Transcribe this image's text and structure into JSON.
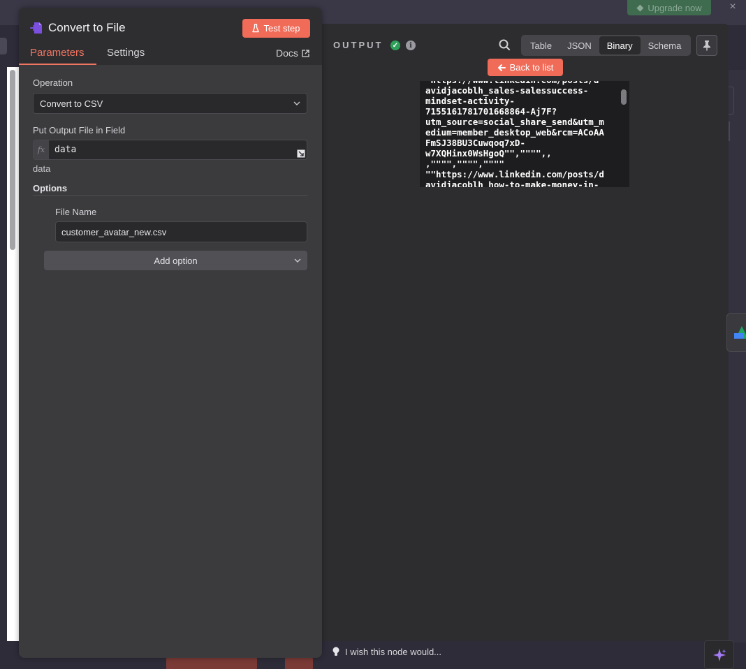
{
  "app": {
    "upgrade_label": "Upgrade now",
    "close_symbol": "×"
  },
  "node": {
    "title": "Convert to File",
    "icon": "convert-file-icon",
    "test_step_label": "Test step",
    "tabs": [
      {
        "label": "Parameters",
        "active": true
      },
      {
        "label": "Settings",
        "active": false
      }
    ],
    "docs_label": "Docs"
  },
  "parameters": {
    "operation_label": "Operation",
    "operation_value": "Convert to CSV",
    "output_field_label": "Put Output File in Field",
    "output_field_fx": "fx",
    "output_field_value": "data",
    "output_field_hint": "data",
    "options_label": "Options",
    "file_name_label": "File Name",
    "file_name_value": "customer_avatar_new.csv",
    "add_option_label": "Add option"
  },
  "output": {
    "title": "OUTPUT",
    "status": "success",
    "view_tabs": [
      {
        "label": "Table",
        "active": false
      },
      {
        "label": "JSON",
        "active": false
      },
      {
        "label": "Binary",
        "active": true
      },
      {
        "label": "Schema",
        "active": false
      }
    ],
    "back_label": "Back to list",
    "binary_preview": "\"https://www.linkedin.com/posts/d\navidjacoblh_sales-salessuccess-\nmindset-activity-\n7155161781701668864-Aj7F?\nutm_source=social_share_send&utm_m\nedium=member_desktop_web&rcm=ACoAA\nFmSJ38BU3Cuwqoq7xD-\nw7XQHinx0WsHgoQ\"\",\"\"\"\",,\n,\"\"\"\",\"\"\"\",\"\"\"\"\n\"\"https://www.linkedin.com/posts/d\navidjacoblh_how-to-make-money-in-",
    "feedback_text": "I wish this node would..."
  },
  "colors": {
    "accent": "#f06b58",
    "success": "#2fa05a",
    "panel_bg": "#3b3b3e",
    "output_bg": "#2d2d2f"
  }
}
